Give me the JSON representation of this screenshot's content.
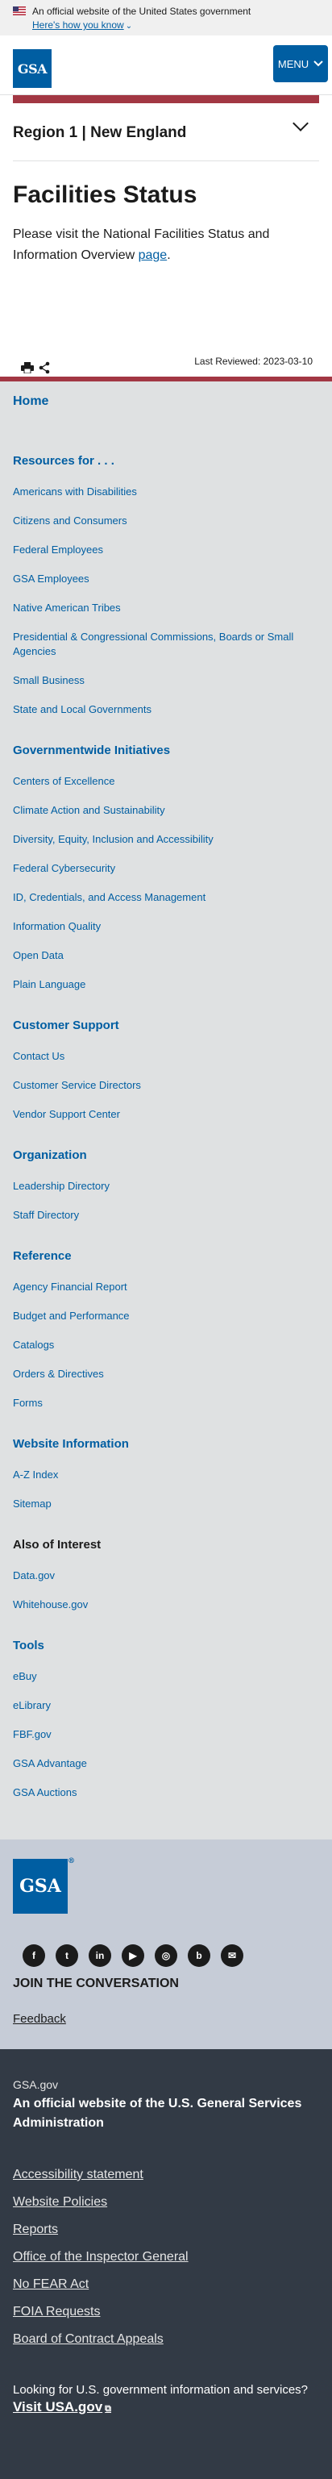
{
  "gov_banner": {
    "official_text": "An official website of the United States government",
    "how_know": "Here's how you know"
  },
  "header": {
    "logo_text": "GSA",
    "menu_label": "MENU"
  },
  "region": {
    "title": "Region 1 | New England"
  },
  "main": {
    "title": "Facilities Status",
    "intro_text": "Please visit the National Facilities Status and Information Overview ",
    "intro_link": "page",
    "intro_end": ".",
    "last_reviewed": "Last Reviewed: 2023-03-10"
  },
  "side_nav": {
    "home": "Home",
    "sections": [
      {
        "heading": "Resources for . . .",
        "links": [
          "Americans with Disabilities",
          "Citizens and Consumers",
          "Federal Employees",
          "GSA Employees",
          "Native American Tribes",
          "Presidential & Congressional Commissions, Boards or Small Agencies",
          "Small Business",
          "State and Local Governments"
        ]
      },
      {
        "heading": "Governmentwide Initiatives",
        "links": [
          "Centers of Excellence",
          "Climate Action and Sustainability",
          "Diversity, Equity, Inclusion and Accessibility",
          "Federal Cybersecurity",
          "ID, Credentials, and Access Management",
          "Information Quality",
          "Open Data",
          "Plain Language"
        ]
      },
      {
        "heading": "Customer Support",
        "links": [
          "Contact Us",
          "Customer Service Directors",
          "Vendor Support Center"
        ]
      },
      {
        "heading": "Organization",
        "links": [
          "Leadership Directory",
          "Staff Directory"
        ]
      },
      {
        "heading": "Reference",
        "links": [
          "Agency Financial Report",
          "Budget and Performance",
          "Catalogs",
          "Orders & Directives",
          "Forms"
        ]
      },
      {
        "heading": "Website Information",
        "links": [
          "A-Z Index",
          "Sitemap"
        ]
      },
      {
        "heading": "Also of Interest",
        "links": [
          "Data.gov",
          "Whitehouse.gov"
        ]
      },
      {
        "heading": "Tools",
        "links": [
          "eBuy",
          "eLibrary",
          "FBF.gov",
          "GSA Advantage",
          "GSA Auctions"
        ]
      }
    ]
  },
  "footer_mid": {
    "logo_text": "GSA",
    "logo_reg": "®",
    "socials": [
      "facebook-icon",
      "twitter-icon",
      "linkedin-icon",
      "youtube-icon",
      "instagram-icon",
      "blog-icon",
      "email-icon"
    ],
    "join": "JOIN THE CONVERSATION",
    "feedback": "Feedback"
  },
  "footer_bot": {
    "site": "GSA.gov",
    "official": "An official website of the U.S. General Services Administration",
    "links": [
      "Accessibility statement",
      "Website Policies",
      "Reports",
      "Office of the Inspector General",
      "No FEAR Act",
      "FOIA Requests",
      "Board of Contract Appeals"
    ],
    "question": "Looking for U.S. government information and services?",
    "visit": "Visit USA.gov"
  },
  "colors": {
    "brand_blue": "#005ea2",
    "accent_red": "#a23743",
    "nav_bg": "#dfe1e2",
    "footer_mid_bg": "#c6ccd7",
    "footer_bot_bg": "#323a45"
  }
}
